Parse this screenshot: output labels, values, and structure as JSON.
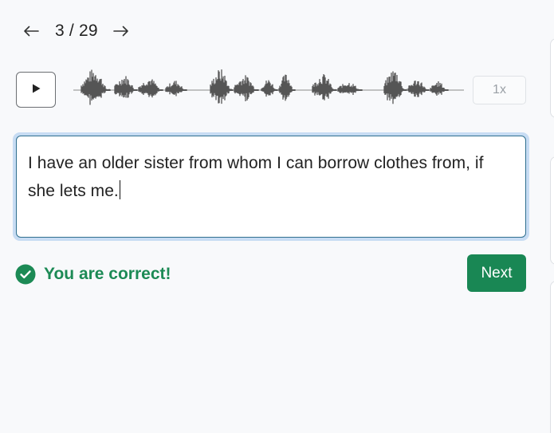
{
  "pager": {
    "prev_icon": "arrow-left-icon",
    "next_icon": "arrow-right-icon",
    "counter": "3 / 29"
  },
  "audio": {
    "play_icon": "play-icon",
    "speed_label": "1x",
    "waveform_color": "#555555"
  },
  "answer": {
    "text": "I have an older sister from whom I can borrow clothes from, if she lets me."
  },
  "feedback": {
    "icon": "check-circle-icon",
    "message": "You are correct!",
    "color": "#1c8a55"
  },
  "actions": {
    "next_label": "Next",
    "next_color": "#198754"
  }
}
